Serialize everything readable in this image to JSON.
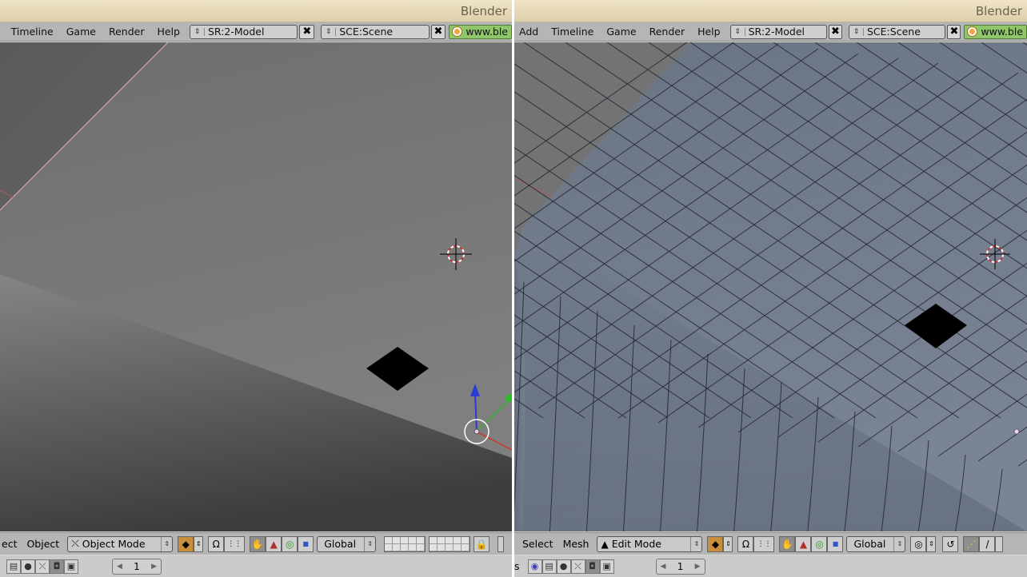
{
  "left": {
    "window_title": "Blender",
    "menu": [
      "Timeline",
      "Game",
      "Render",
      "Help"
    ],
    "screen_field": "SR:2-Model",
    "scene_field": "SCE:Scene",
    "link_text": "www.ble",
    "header_menus": [
      "ect",
      "Object"
    ],
    "mode": "Object Mode",
    "orientation": "Global",
    "frame": "1"
  },
  "right": {
    "window_title": "Blender",
    "menu": [
      "Add",
      "Timeline",
      "Game",
      "Render",
      "Help"
    ],
    "screen_field": "SR:2-Model",
    "scene_field": "SCE:Scene",
    "link_text": "www.ble",
    "header_menus": [
      "Select",
      "Mesh"
    ],
    "mode": "Edit Mode",
    "orientation": "Global",
    "footer_prefix": "s",
    "frame": "1"
  },
  "icons": {
    "clear": "close-icon",
    "link": "blender-logo-icon",
    "mode": "object-mode-icon",
    "pivot": "pivot-icon",
    "magnet": "magnet-icon",
    "hand": "hand-icon",
    "lock": "lock-icon"
  },
  "colors": {
    "titlebar": "#e6dab9",
    "menubar": "#b5b5b5",
    "viewport_grey": "#7a7a7a",
    "mesh_blue": "#6f7a88",
    "link_green": "#8fc66a",
    "cursor_red": "#cc3333",
    "widget_blue": "#2a3cd6",
    "widget_green": "#2db82d"
  }
}
